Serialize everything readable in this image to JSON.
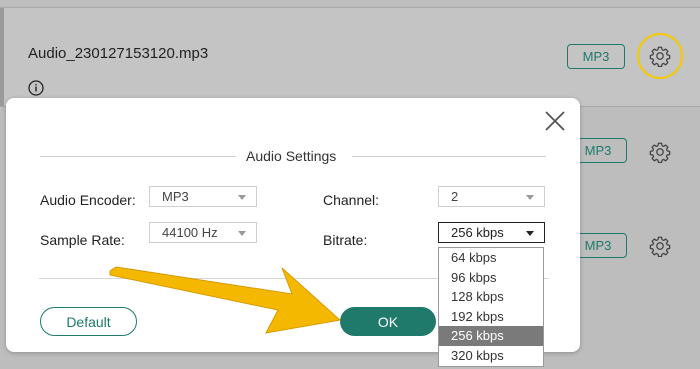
{
  "background": {
    "file_name": "Audio_230127153120.mp3",
    "rows": [
      {
        "format_label": "MP3"
      },
      {
        "format_label": "MP3"
      },
      {
        "format_label": "MP3"
      }
    ]
  },
  "dialog": {
    "title": "Audio Settings",
    "audio_encoder": {
      "label": "Audio Encoder:",
      "value": "MP3"
    },
    "sample_rate": {
      "label": "Sample Rate:",
      "value": "44100 Hz"
    },
    "channel": {
      "label": "Channel:",
      "value": "2"
    },
    "bitrate": {
      "label": "Bitrate:",
      "value": "256 kbps",
      "options": [
        "64 kbps",
        "96 kbps",
        "128 kbps",
        "192 kbps",
        "256 kbps",
        "320 kbps"
      ],
      "selected_index": 4
    },
    "default_button": "Default",
    "ok_button": "OK"
  },
  "colors": {
    "accent": "#1f7a6b",
    "highlight": "#f5c800",
    "annotation_arrow": "#f5b800"
  },
  "icons": [
    "info-icon",
    "gear-icon",
    "close-icon",
    "chevron-down-icon",
    "arrow-annotation"
  ]
}
